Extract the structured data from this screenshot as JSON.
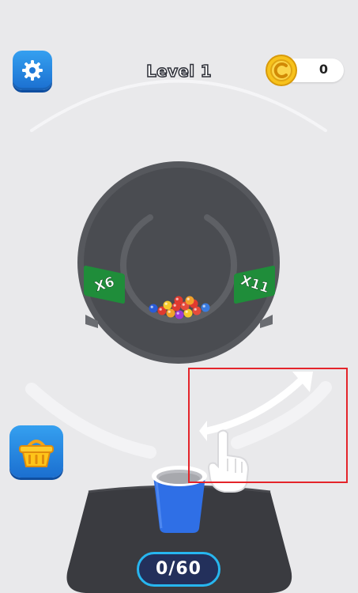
{
  "header": {
    "level_title": "Level 1",
    "coins": "0",
    "settings_icon": "gear-icon",
    "coin_icon": "coin-icon"
  },
  "board": {
    "left_multiplier": "X6",
    "right_multiplier": "X11",
    "ball_colors": [
      "#2a5bd7",
      "#e03a2f",
      "#f2a12a",
      "#f5c92b",
      "#9b3ad6",
      "#3a7be0",
      "#e54b3b"
    ]
  },
  "cup": {
    "count_label": "0/60",
    "color": "#2f6fe6"
  },
  "shop": {
    "icon": "basket-icon"
  },
  "tutorial": {
    "gesture_icon": "pointing-hand-icon",
    "arrow_icon": "curved-arrow-icon"
  },
  "colors": {
    "background": "#e9e9eb",
    "ring": "#4a4c51",
    "multiplier_green": "#1f8d3a",
    "button_blue": "#1e86e0",
    "highlight_red": "#e4242a"
  }
}
